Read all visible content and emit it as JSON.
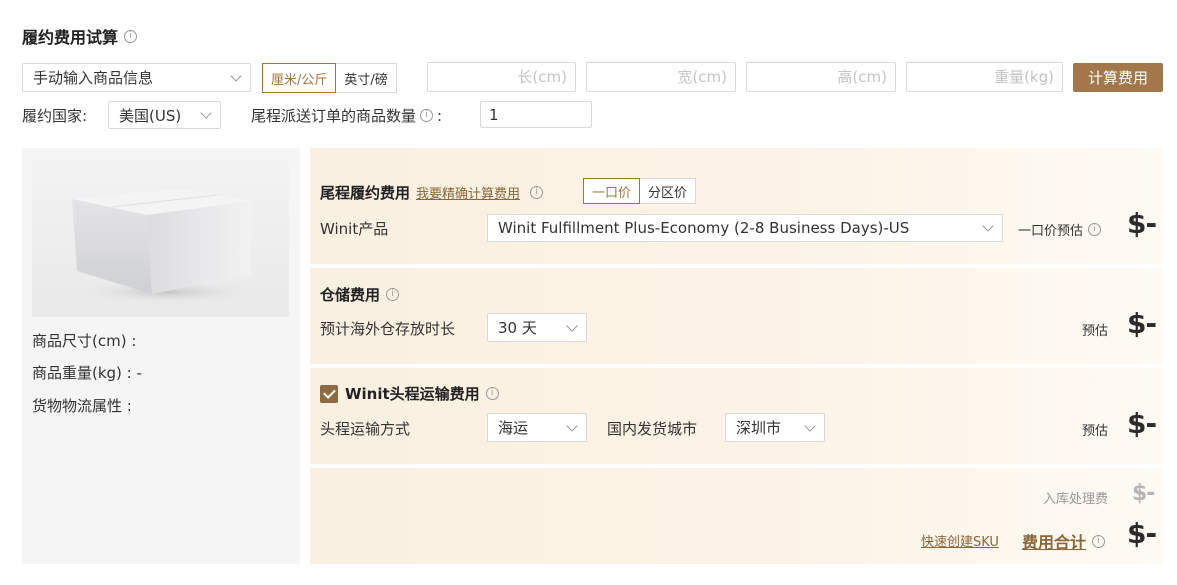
{
  "header": {
    "title": "履约费用试算",
    "info_icon": "info-circle-icon"
  },
  "input_row": {
    "mode_select": "手动输入商品信息",
    "units": [
      {
        "label": "厘米/公斤",
        "active": true
      },
      {
        "label": "英寸/磅",
        "active": false
      }
    ],
    "length_placeholder": "长(cm)",
    "width_placeholder": "宽(cm)",
    "height_placeholder": "高(cm)",
    "weight_placeholder": "重量(kg)",
    "calc_button": "计算费用"
  },
  "country_row": {
    "country_label": "履约国家:",
    "country_value": "美国(US)",
    "qty_label": "尾程派送订单的商品数量",
    "qty_colon": ":",
    "qty_value": "1"
  },
  "product": {
    "size_label": "商品尺寸(cm) :",
    "weight_label": "商品重量(kg) : -",
    "logistics_label": "货物物流属性 :"
  },
  "last_mile": {
    "title": "尾程履约费用",
    "precise_link": "我要精确计算费用",
    "pricing_tabs": [
      {
        "label": "一口价",
        "active": true
      },
      {
        "label": "分区价",
        "active": false
      }
    ],
    "product_label": "Winit产品",
    "product_value": "Winit Fulfillment Plus-Economy (2-8 Business Days)-US",
    "estimate_label": "一口价预估",
    "price": "$-"
  },
  "storage": {
    "title": "仓储费用",
    "duration_label": "预计海外仓存放时长",
    "duration_value": "30 天",
    "estimate_label": "预估",
    "price": "$-"
  },
  "first_leg": {
    "checked": true,
    "title": "Winit头程运输费用",
    "method_label": "头程运输方式",
    "method_value": "海运",
    "city_label": "国内发货城市",
    "city_value": "深圳市",
    "estimate_label": "预估",
    "price": "$-"
  },
  "total": {
    "inbound_label": "入库处理费",
    "inbound_price": "$-",
    "create_sku_link": "快速创建SKU",
    "total_label": "费用合计",
    "total_price": "$-"
  },
  "colors": {
    "accent": "#a2784a",
    "section_bg": "#faf0e1",
    "left_panel_bg": "#f5f5f5"
  }
}
